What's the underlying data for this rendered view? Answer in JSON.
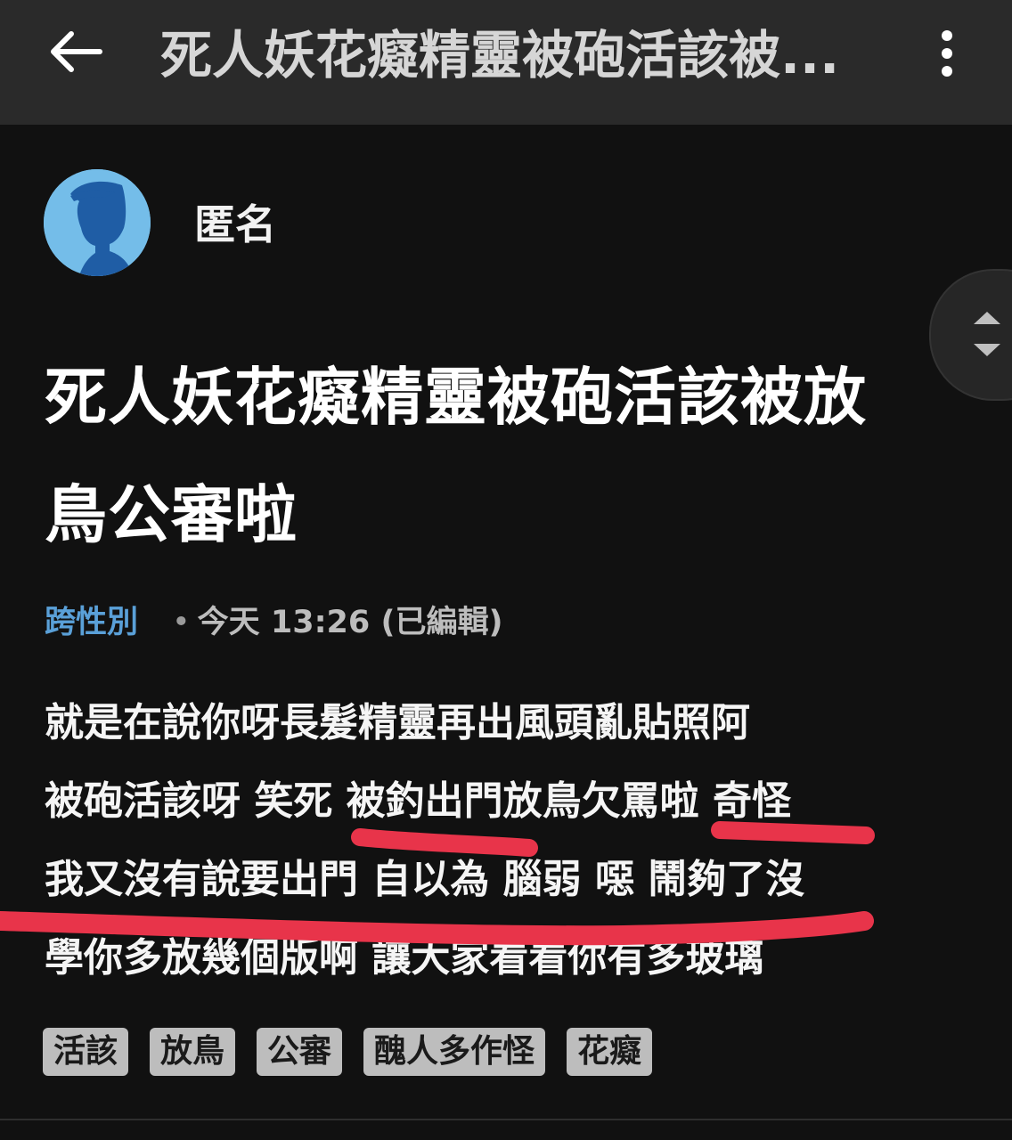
{
  "appbar": {
    "back_icon": "arrow-left-icon",
    "title": "死人妖花癡精靈被砲活該被...",
    "more_icon": "more-vertical-icon"
  },
  "author": {
    "avatar_icon": "anonymous-avatar-icon",
    "name": "匿名"
  },
  "scroll_control": {
    "up_icon": "triangle-up-icon",
    "down_icon": "triangle-down-icon"
  },
  "post": {
    "title_lines": [
      "死人妖花癡精靈被砲活該被放",
      "鳥公審啦"
    ],
    "board": "跨性別",
    "separator": "•",
    "time": "今天 13:26 (已編輯)",
    "body_lines": [
      "就是在說你呀長髮精靈再出風頭亂貼照阿",
      "被砲活該呀 笑死 被釣出門放鳥欠罵啦 奇怪",
      "我又沒有說要出門 自以為 腦弱 噁 鬧夠了沒",
      "學你多放幾個版啊 讓大家看看你有多玻璃"
    ]
  },
  "tags": [
    "活該",
    "放鳥",
    "公審",
    "醜人多作怪",
    "花癡"
  ],
  "colors": {
    "background": "#111111",
    "appbar": "#2a2a2a",
    "board_link": "#5aa0d8",
    "highlight_stroke": "#e8344a",
    "tag_bg": "#bdbdbd"
  }
}
